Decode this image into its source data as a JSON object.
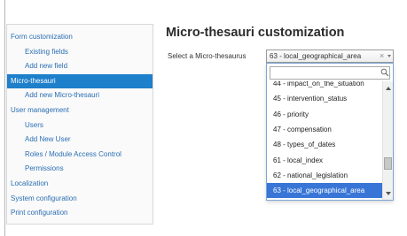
{
  "sidebar": {
    "items": [
      {
        "label": "Form customization",
        "level": "top",
        "active": false
      },
      {
        "label": "Existing fields",
        "level": "sub",
        "active": false
      },
      {
        "label": "Add new field",
        "level": "sub",
        "active": false
      },
      {
        "label": "Micro-thesauri",
        "level": "top",
        "active": true
      },
      {
        "label": "Add new Micro-thesauri",
        "level": "sub",
        "active": false
      },
      {
        "label": "User management",
        "level": "top",
        "active": false
      },
      {
        "label": "Users",
        "level": "sub",
        "active": false
      },
      {
        "label": "Add New User",
        "level": "sub",
        "active": false
      },
      {
        "label": "Roles / Module Access Control",
        "level": "sub",
        "active": false
      },
      {
        "label": "Permissions",
        "level": "sub",
        "active": false
      },
      {
        "label": "Localization",
        "level": "top",
        "active": false
      },
      {
        "label": "System configuration",
        "level": "top",
        "active": false
      },
      {
        "label": "Print configuration",
        "level": "top",
        "active": false
      }
    ]
  },
  "main": {
    "title": "Micro-thesauri customization",
    "select_label": "Select a Micro-thesaurus",
    "select": {
      "value": "63 - local_geographical_area",
      "clear_symbol": "×",
      "search_value": "",
      "options": [
        {
          "label": "44 - impact_on_the_situation",
          "selected": false
        },
        {
          "label": "45 - intervention_status",
          "selected": false
        },
        {
          "label": "46 - priority",
          "selected": false
        },
        {
          "label": "47 - compensation",
          "selected": false
        },
        {
          "label": "48 - types_of_dates",
          "selected": false
        },
        {
          "label": "61 - local_index",
          "selected": false
        },
        {
          "label": "62 - national_legislation",
          "selected": false
        },
        {
          "label": "63 - local_geographical_area",
          "selected": true
        }
      ]
    }
  },
  "colors": {
    "link": "#2a6eb3",
    "active_bg": "#1e7fcb",
    "selected_option_bg": "#3875d7"
  }
}
